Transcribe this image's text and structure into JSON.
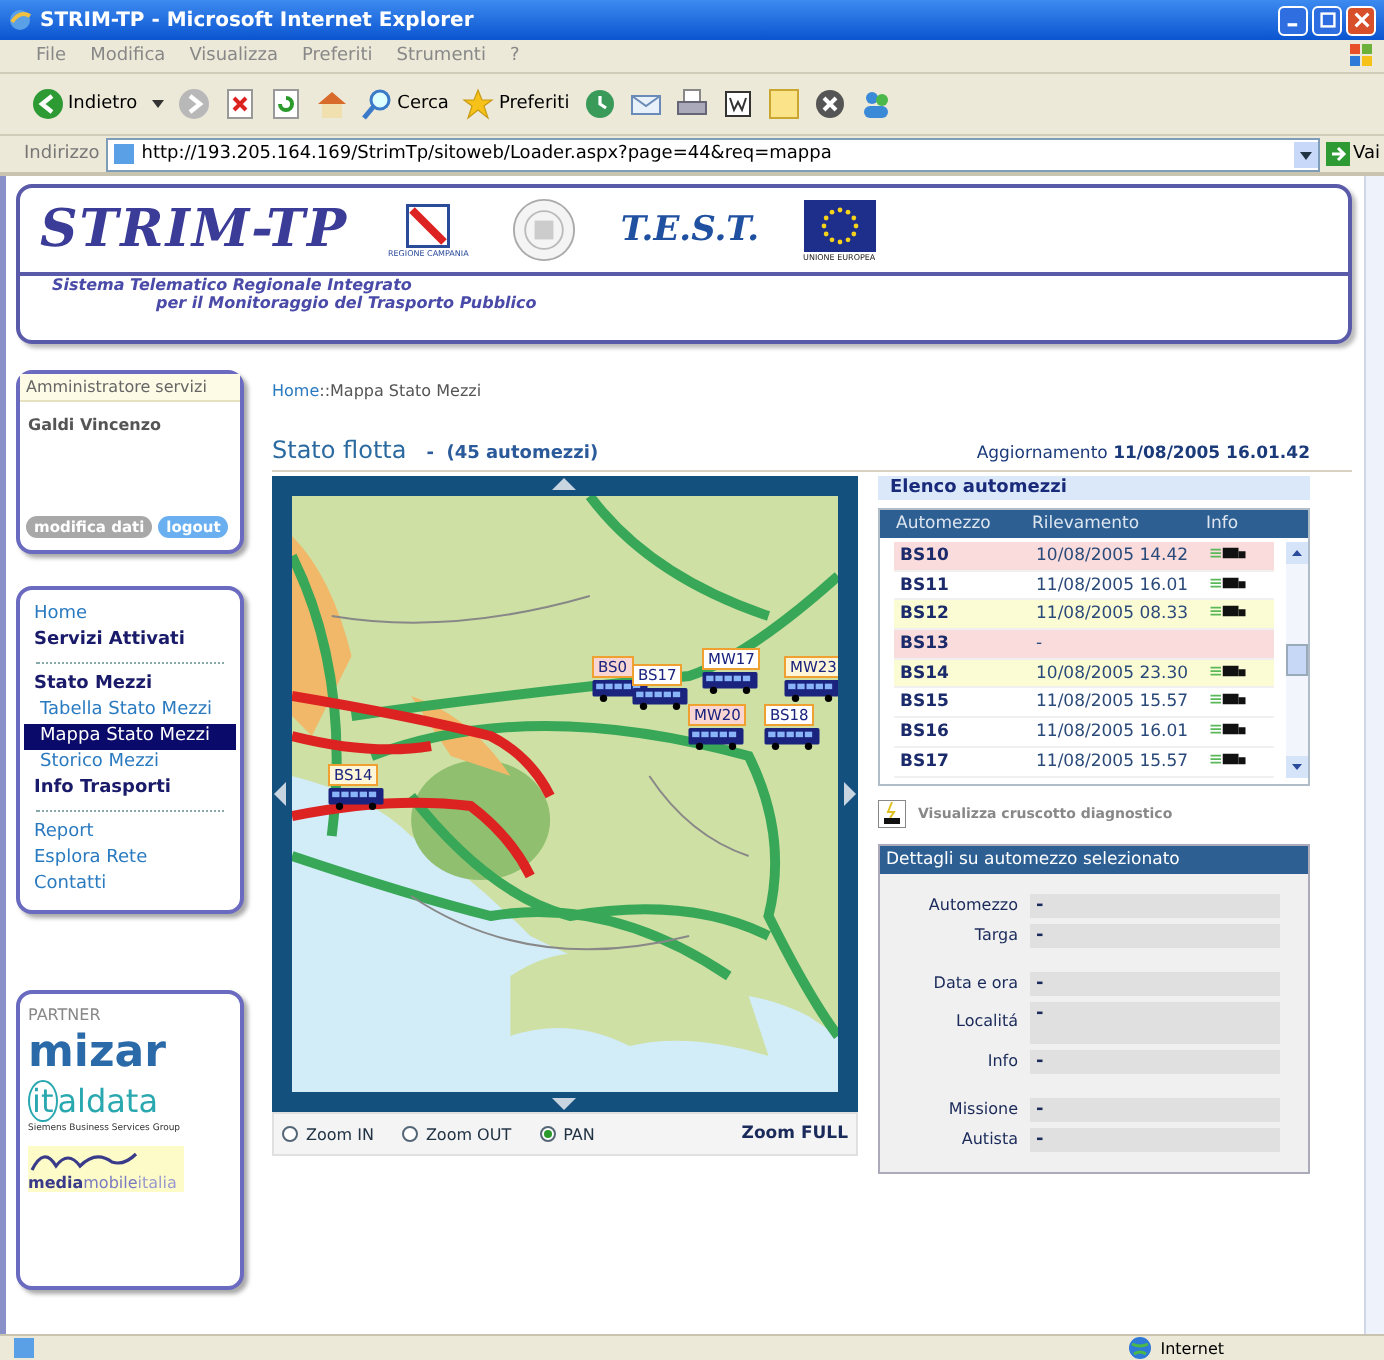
{
  "window": {
    "title": "STRIM-TP - Microsoft Internet Explorer"
  },
  "menu": [
    "File",
    "Modifica",
    "Visualizza",
    "Preferiti",
    "Strumenti",
    "?"
  ],
  "toolbar": {
    "back": "Indietro",
    "search": "Cerca",
    "favorites": "Preferiti"
  },
  "address": {
    "label": "Indirizzo",
    "url": "http://193.205.164.169/StrimTp/sitoweb/Loader.aspx?page=44&req=mappa",
    "go": "Vai"
  },
  "header": {
    "logo": "STRIM-TP",
    "subtitle_1": "Sistema Telematico Regionale Integrato",
    "subtitle_2": "per il Monitoraggio del Trasporto Pubblico",
    "region_caption": "REGIONE CAMPANIA",
    "test_logo": "T.E.S.T.",
    "eu_caption": "UNIONE EUROPEA"
  },
  "user": {
    "role": "Amministratore servizi",
    "name": "Galdi Vincenzo",
    "buttons": [
      {
        "label": "modifica dati",
        "kind": "secondary"
      },
      {
        "label": "logout",
        "kind": "primary"
      }
    ]
  },
  "nav": [
    {
      "label": "Home",
      "kind": "link",
      "selected": false
    },
    {
      "label": "Servizi Attivati",
      "kind": "heading",
      "selected": false
    },
    {
      "kind": "divider"
    },
    {
      "label": "Stato Mezzi",
      "kind": "heading",
      "selected": false
    },
    {
      "label": "Tabella Stato Mezzi",
      "kind": "sub",
      "selected": false
    },
    {
      "label": "Mappa Stato Mezzi",
      "kind": "sub",
      "selected": true
    },
    {
      "label": "Storico Mezzi",
      "kind": "sub",
      "selected": false
    },
    {
      "label": "Info Trasporti",
      "kind": "heading",
      "selected": false
    },
    {
      "kind": "divider"
    },
    {
      "label": "Report",
      "kind": "link",
      "selected": false
    },
    {
      "label": "Esplora Rete",
      "kind": "link",
      "selected": false
    },
    {
      "label": "Contatti",
      "kind": "link",
      "selected": false
    }
  ],
  "partners": {
    "title": "PARTNER",
    "mizar": "mizar",
    "italdata": "aldata",
    "italdata_prefix": "it",
    "italdata_caption": "Siemens Business Services Group",
    "media_1": "media",
    "media_2": "mobile",
    "media_3": "italia"
  },
  "breadcrumb": {
    "link": "Home",
    "rest": "::Mappa Stato Mezzi"
  },
  "title": "Stato flotta",
  "count": "-  (45 automezzi)",
  "updated": {
    "label": "Aggiornamento",
    "value": "11/08/2005 16.01.42"
  },
  "map": {
    "markers": [
      {
        "label": "BS0",
        "color": "#f9d6d2"
      },
      {
        "label": "BS17",
        "color": "#ffffff"
      },
      {
        "label": "MW17",
        "color": "#ffffff"
      },
      {
        "label": "MW23",
        "color": "#fff6d8"
      },
      {
        "label": "MW20",
        "color": "#f9d6d2"
      },
      {
        "label": "BS18",
        "color": "#ffffff"
      },
      {
        "label": "BS14",
        "color": "#fff6d8"
      }
    ],
    "modes": [
      {
        "label": "Zoom IN",
        "selected": false
      },
      {
        "label": "Zoom OUT",
        "selected": false
      },
      {
        "label": "PAN",
        "selected": true
      }
    ],
    "zoom_full": "Zoom FULL"
  },
  "vehicles": {
    "title": "Elenco automezzi",
    "columns": [
      "Automezzo",
      "Rilevamento",
      "Info"
    ],
    "rows": [
      {
        "id": "BS10",
        "time": "10/08/2005 14.42",
        "color": "#fadcdc",
        "info": true
      },
      {
        "id": "BS11",
        "time": "11/08/2005 16.01",
        "color": "#ffffff",
        "info": true
      },
      {
        "id": "BS12",
        "time": "11/08/2005 08.33",
        "color": "#fcfcd4",
        "info": true
      },
      {
        "id": "BS13",
        "time": "-",
        "color": "#fadcdc",
        "info": false
      },
      {
        "id": "BS14",
        "time": "10/08/2005 23.30",
        "color": "#fcfcd4",
        "info": true
      },
      {
        "id": "BS15",
        "time": "11/08/2005 15.57",
        "color": "#ffffff",
        "info": true
      },
      {
        "id": "BS16",
        "time": "11/08/2005 16.01",
        "color": "#ffffff",
        "info": true
      },
      {
        "id": "BS17",
        "time": "11/08/2005 15.57",
        "color": "#ffffff",
        "info": true
      }
    ]
  },
  "diagnostic": "Visualizza cruscotto diagnostico",
  "details": {
    "title": "Dettagli su automezzo selezionato",
    "groups": [
      {
        "fields": [
          {
            "label": "Automezzo",
            "value": "-",
            "tall": false
          },
          {
            "label": "Targa",
            "value": "-",
            "tall": false
          }
        ]
      },
      {
        "fields": [
          {
            "label": "Data e ora",
            "value": "-",
            "tall": false
          },
          {
            "label": "Localitá",
            "value": "-",
            "tall": true
          },
          {
            "label": "Info",
            "value": "-",
            "tall": false
          }
        ]
      },
      {
        "fields": [
          {
            "label": "Missione",
            "value": "-",
            "tall": false
          },
          {
            "label": "Autista",
            "value": "-",
            "tall": false
          }
        ]
      }
    ]
  },
  "status_bar": {
    "zone": "Internet"
  }
}
